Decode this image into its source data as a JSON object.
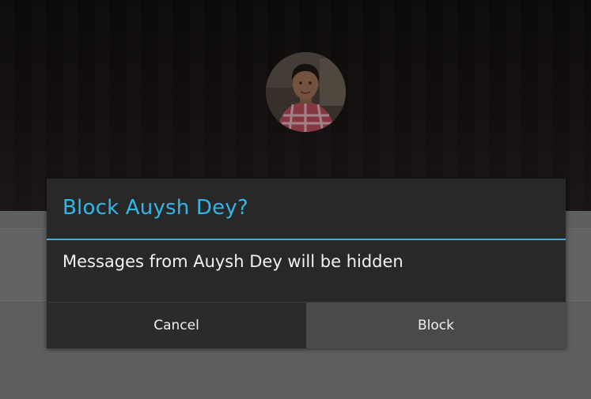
{
  "dialog": {
    "title": "Block Auysh Dey?",
    "message": "Messages from Auysh Dey will be hidden",
    "cancel_label": "Cancel",
    "block_label": "Block"
  },
  "colors": {
    "accent": "#33b5e5",
    "dialog_bg": "#282828",
    "selected_button_bg": "#4a4a4a"
  },
  "icons": {
    "avatar": "profile-photo"
  }
}
